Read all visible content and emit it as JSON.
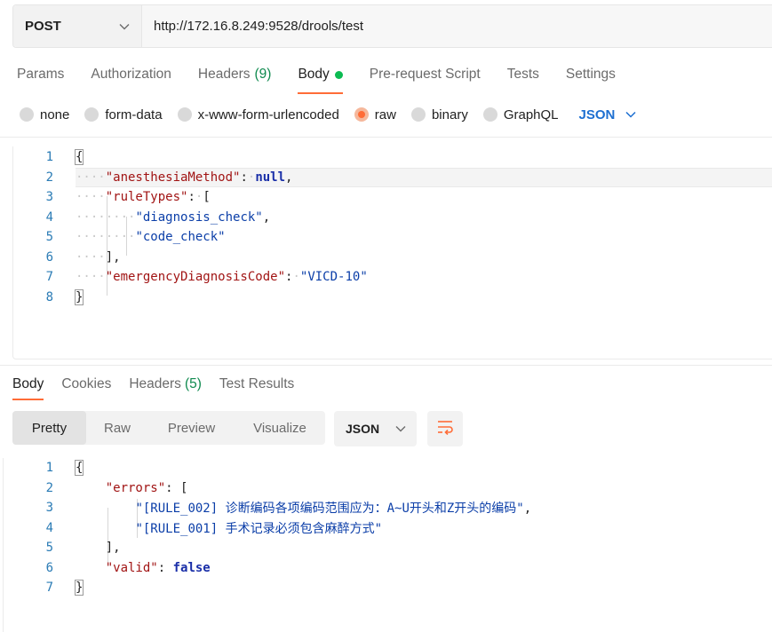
{
  "request": {
    "method": "POST",
    "url": "http://172.16.8.249:9528/drools/test"
  },
  "request_tabs": [
    {
      "label": "Params"
    },
    {
      "label": "Authorization"
    },
    {
      "label": "Headers",
      "count": "(9)"
    },
    {
      "label": "Body"
    },
    {
      "label": "Pre-request Script"
    },
    {
      "label": "Tests"
    },
    {
      "label": "Settings"
    }
  ],
  "body_types": [
    {
      "label": "none"
    },
    {
      "label": "form-data"
    },
    {
      "label": "x-www-form-urlencoded"
    },
    {
      "label": "raw"
    },
    {
      "label": "binary"
    },
    {
      "label": "GraphQL"
    }
  ],
  "body_format": "JSON",
  "request_body": {
    "line_numbers": [
      "1",
      "2",
      "3",
      "4",
      "5",
      "6",
      "7",
      "8"
    ],
    "open_brace": "{",
    "close_brace": "}",
    "key1": "\"anesthesiaMethod\"",
    "val1": "null",
    "key2": "\"ruleTypes\"",
    "item1": "\"diagnosis_check\"",
    "item2": "\"code_check\"",
    "key3": "\"emergencyDiagnosisCode\"",
    "val3": "\"VICD-10\""
  },
  "response_tabs": [
    {
      "label": "Body"
    },
    {
      "label": "Cookies"
    },
    {
      "label": "Headers",
      "count": "(5)"
    },
    {
      "label": "Test Results"
    }
  ],
  "view_modes": [
    {
      "label": "Pretty"
    },
    {
      "label": "Raw"
    },
    {
      "label": "Preview"
    },
    {
      "label": "Visualize"
    }
  ],
  "response_format": "JSON",
  "response_body": {
    "line_numbers": [
      "1",
      "2",
      "3",
      "4",
      "5",
      "6",
      "7"
    ],
    "open_brace": "{",
    "close_brace": "}",
    "key1": "\"errors\"",
    "err1": "\"[RULE_002] 诊断编码各项编码范围应为：A~U开头和Z开头的编码\"",
    "err2": "\"[RULE_001] 手术记录必须包含麻醉方式\"",
    "key2": "\"valid\"",
    "val2": "false"
  },
  "icons": {
    "method_dropdown": "chevron-down-icon",
    "wrap_lines": "wrap-lines-icon"
  },
  "colors": {
    "accent": "#ff6c37",
    "count_green": "#0f8a4f",
    "status_dot": "#0cbb52",
    "link_blue": "#1d6fd1",
    "json_key": "#a11414",
    "json_string": "#0b3ea8"
  }
}
